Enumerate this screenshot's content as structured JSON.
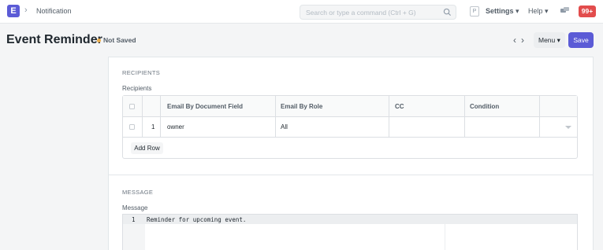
{
  "navbar": {
    "logo_letter": "E",
    "breadcrumb_sep": "›",
    "breadcrumb": "Notification",
    "search_placeholder": "Search or type a command (Ctrl + G)",
    "avatar_letter": "P",
    "settings_label": "Settings ▾",
    "help_label": "Help ▾",
    "notification_count": "99+"
  },
  "page_head": {
    "title": "Event Reminder",
    "status": "Not Saved",
    "prev_label": "‹",
    "next_label": "›",
    "menu_label": "Menu ▾",
    "save_label": "Save"
  },
  "recipients_section": {
    "heading": "RECIPIENTS",
    "field_label": "Recipients",
    "columns": [
      "Email By Document Field",
      "Email By Role",
      "CC",
      "Condition"
    ],
    "rows": [
      {
        "idx": "1",
        "email_by_document_field": "owner",
        "email_by_role": "All",
        "cc": "",
        "condition": ""
      }
    ],
    "add_row_label": "Add Row"
  },
  "message_section": {
    "heading": "MESSAGE",
    "field_label": "Message",
    "lines": [
      {
        "number": "1",
        "text": "Reminder for upcoming event."
      }
    ]
  },
  "colors": {
    "accent": "#5b5bd6",
    "badge": "#e24c4c",
    "status_dot": "#ecad4b"
  }
}
